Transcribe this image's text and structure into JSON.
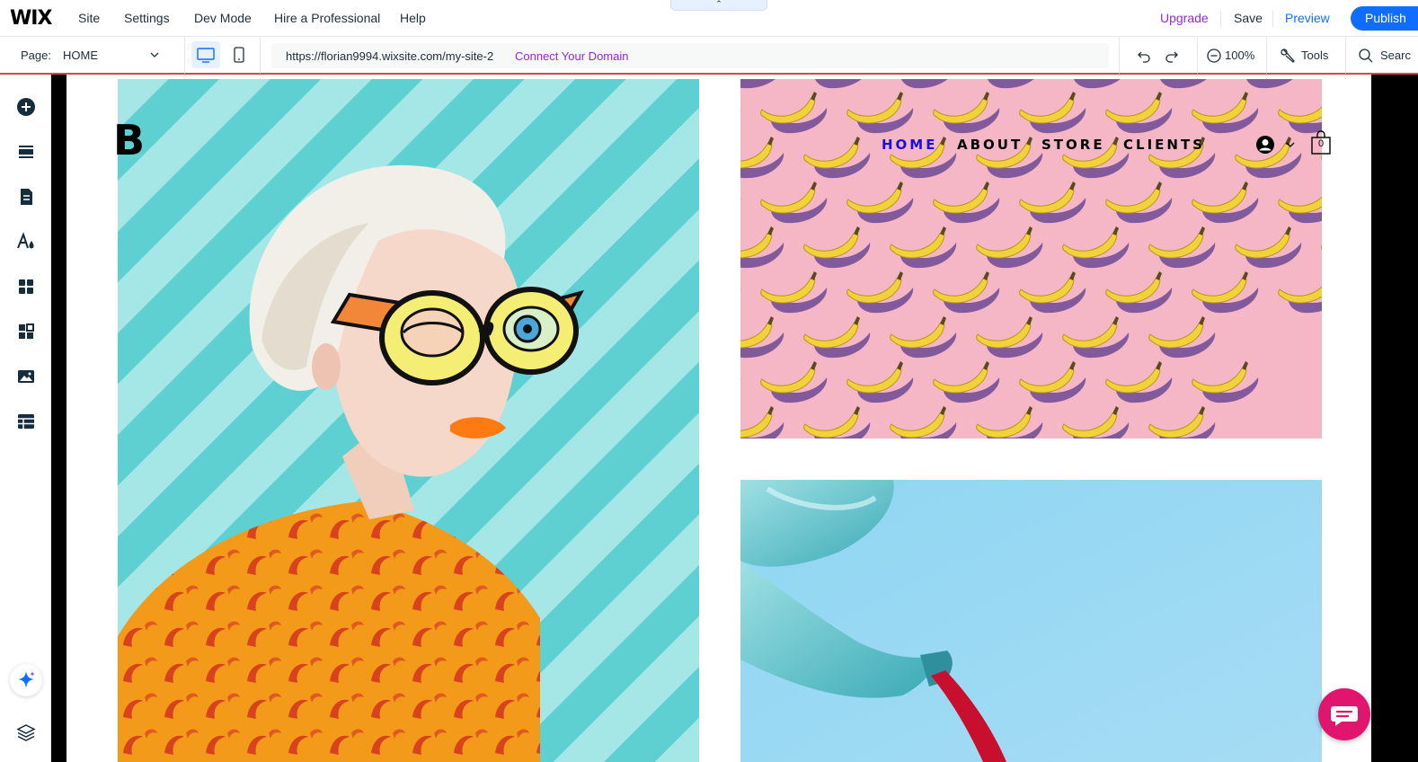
{
  "editor": {
    "logo": "WIX",
    "menu": {
      "site": "Site",
      "settings": "Settings",
      "dev_mode": "Dev Mode",
      "hire": "Hire a Professional",
      "help": "Help"
    },
    "collapse_chevron": "⌃",
    "actions": {
      "upgrade": "Upgrade",
      "save": "Save",
      "preview": "Preview",
      "publish": "Publish"
    },
    "toolbar": {
      "page_label": "Page:",
      "page_value": "HOME",
      "url": "https://florian9994.wixsite.com/my-site-2",
      "connect_domain": "Connect Your Domain",
      "zoom": "100%",
      "tools": "Tools",
      "search": "Searc"
    },
    "left_tools": [
      "add-elements",
      "sections",
      "pages",
      "site-design",
      "apps",
      "add-ons",
      "media",
      "cms"
    ],
    "colors": {
      "accent": "#116dff",
      "upgrade": "#9a27d5",
      "page_outline": "#d14a4a"
    }
  },
  "site": {
    "logo": "B",
    "nav": [
      "HOME",
      "ABOUT",
      "STORE",
      "CLIENTS"
    ],
    "active_nav": "HOME",
    "cart_count": "0",
    "images": [
      "woman-with-glasses",
      "bananas-pattern",
      "teapot-pouring"
    ],
    "colors": {
      "nav_active": "#1a0dde",
      "chat_button": "#e0156e"
    }
  }
}
